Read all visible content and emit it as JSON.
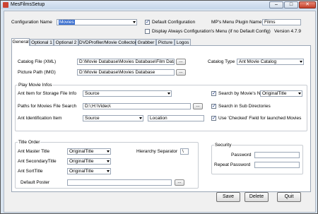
{
  "window": {
    "title": "MesFilmsSetup",
    "min": "–",
    "max": "□",
    "close": "✕"
  },
  "top": {
    "config_label": "Configuration Name",
    "config_value": "Movies",
    "default_config": "Default Configuration",
    "default_checked": true,
    "display_always": "Display Always Configuration's Menu (if no Default Config)",
    "display_checked": false,
    "plugin_name_label": "MP's Menu Plugin Name",
    "plugin_name_value": "Films",
    "version": "Version 4.7.9"
  },
  "tabs": [
    "General",
    "Optional 1",
    "Optional 2",
    "DVDProfiler/Movie Collector",
    "Grabber",
    "Picture",
    "Logos"
  ],
  "general": {
    "catalog_file_label": "Catalog File (XML)",
    "catalog_file_value": "D:\\Movie Database\\Movies Database\\Film Datab",
    "picture_path_label": "Picture Path  (IMG)",
    "picture_path_value": "D:\\Movie Database\\Movies Database",
    "browse": "...",
    "catalog_type_label": "Catalog Type",
    "catalog_type_value": "Ant Movie Catalog",
    "play_group": "Play Movie Infos",
    "ant_item_label": "Ant Item for Storage  File Info",
    "ant_item_value": "Source",
    "paths_label": "Paths for Movies File Search",
    "paths_value": "D:\\;H:\\Video\\",
    "ant_id_label": "Ant Identification Item",
    "ant_id_value": "Source",
    "ant_id_text": "Location",
    "search_name_label": "Search by Movie's Name",
    "search_name_checked": true,
    "search_name_value": "OriginalTitle",
    "search_sub_label": "Search in Sub Directories",
    "search_sub_checked": true,
    "use_checked_label": "Use 'Checked' Field for launched Movies",
    "use_checked_checked": true,
    "title_group": "Title Order",
    "master_label": "Ant Master Title",
    "master_value": "OriginalTitle",
    "secondary_label": "Ant SecondaryTitle",
    "secondary_value": "OriginalTitle",
    "sort_label": "Ant SortTitle",
    "sort_value": "OriginalTitle",
    "hierarchy_label": "Hierarchy Separator",
    "hierarchy_value": "\\",
    "default_poster_label": "Default Poster",
    "default_poster_value": "",
    "security_group": "Security",
    "password_label": "Password",
    "password_value": "",
    "repeat_label": "Repeat Password",
    "repeat_value": ""
  },
  "buttons": {
    "save": "Save",
    "delete": "Delete",
    "quit": "Quit"
  }
}
